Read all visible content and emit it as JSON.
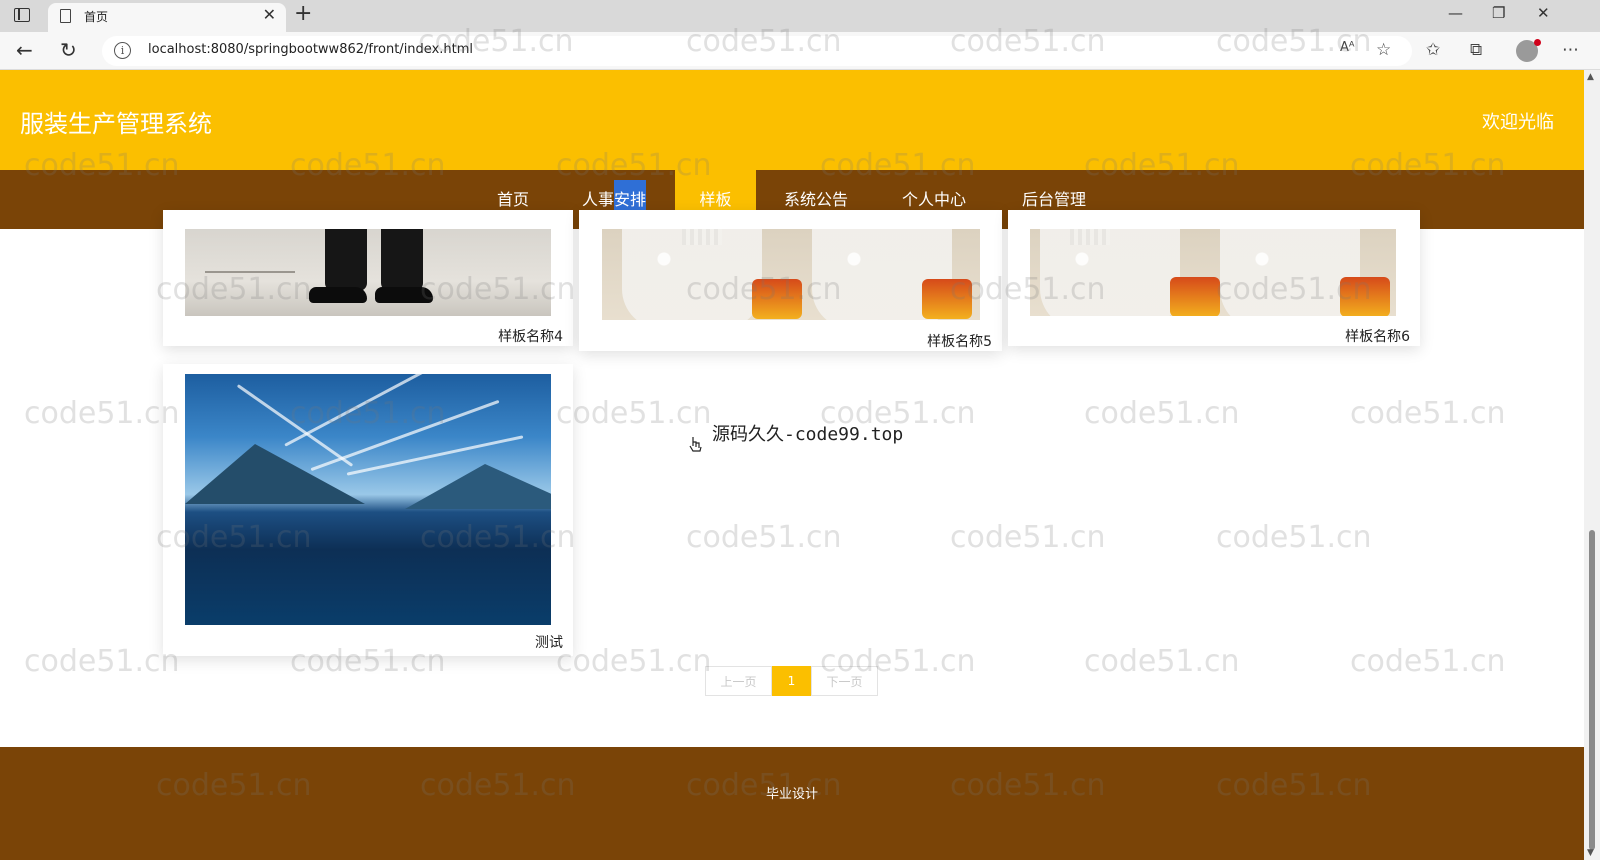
{
  "browser": {
    "tab_title": "首页",
    "tab_close": "✕",
    "new_tab": "+",
    "url": "localhost:8080/springbootww862/front/index.html",
    "icons": [
      "sidebar-toggle-icon",
      "page-icon",
      "back-arrow-icon",
      "reload-icon",
      "info-icon",
      "read-aloud-icon",
      "add-favorite-icon",
      "favorites-icon",
      "collections-icon",
      "profile-icon",
      "more-icon"
    ],
    "window": {
      "minimize": "—",
      "restore": "❐",
      "close": "✕"
    }
  },
  "header": {
    "title": "服装生产管理系统",
    "welcome": "欢迎光临",
    "bg_color": "#fbbf00"
  },
  "nav": {
    "items": [
      {
        "label": "首页"
      },
      {
        "label_a": "人事",
        "label_b": "安排"
      },
      {
        "label": "样板"
      },
      {
        "label": "系统公告"
      },
      {
        "label": "个人中心"
      },
      {
        "label": "后台管理"
      }
    ],
    "active_index": 2,
    "bg_color": "#7a4407"
  },
  "samples": [
    {
      "name": "样板名称4"
    },
    {
      "name": "样板名称5"
    },
    {
      "name": "样板名称6"
    },
    {
      "name": "测试"
    }
  ],
  "notice": "源码久久-code99.top",
  "pager": {
    "prev": "上一页",
    "current": "1",
    "next": "下一页"
  },
  "footer": {
    "text": "毕业设计"
  },
  "watermark": "code51.cn"
}
